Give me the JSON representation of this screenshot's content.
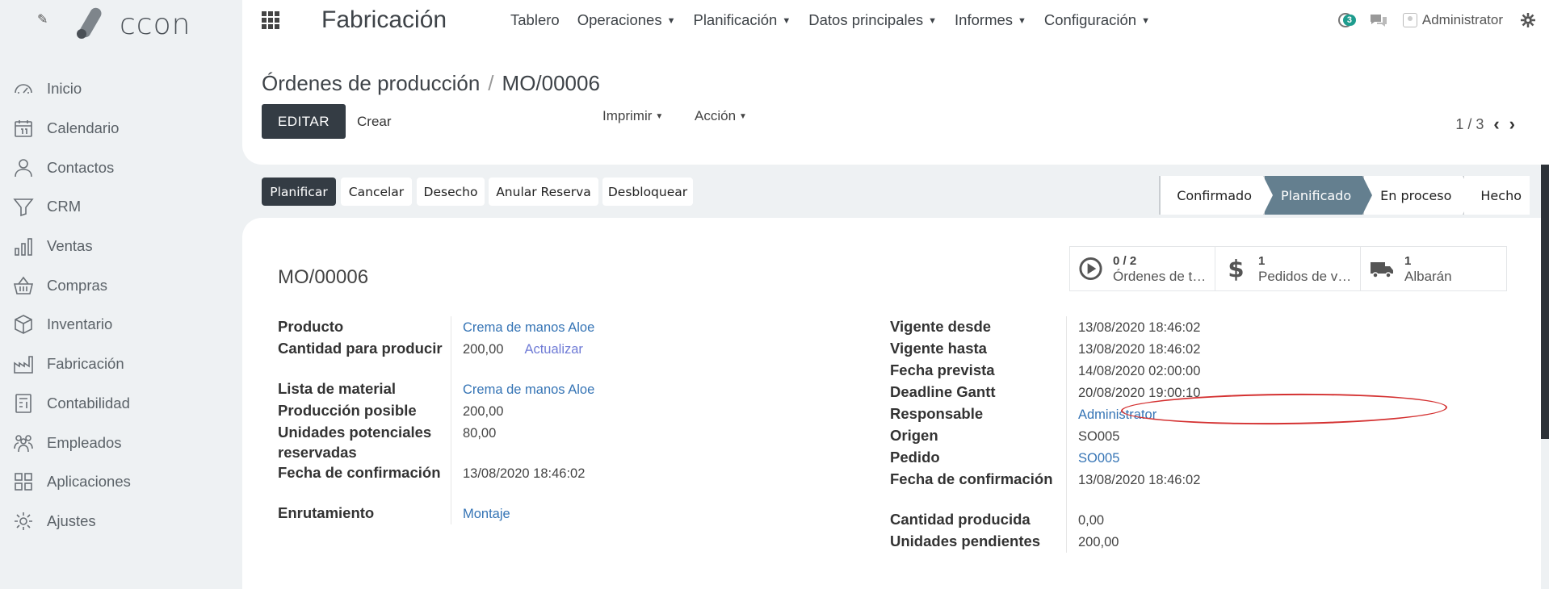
{
  "brand": {
    "logo_text": "ccon"
  },
  "sidebar": {
    "items": [
      {
        "label": "Inicio",
        "icon": "dashboard-icon"
      },
      {
        "label": "Calendario",
        "icon": "calendar-icon"
      },
      {
        "label": "Contactos",
        "icon": "person-icon"
      },
      {
        "label": "CRM",
        "icon": "filter-icon"
      },
      {
        "label": "Ventas",
        "icon": "chart-icon"
      },
      {
        "label": "Compras",
        "icon": "basket-icon"
      },
      {
        "label": "Inventario",
        "icon": "box-icon"
      },
      {
        "label": "Fabricación",
        "icon": "factory-icon"
      },
      {
        "label": "Contabilidad",
        "icon": "accounting-icon"
      },
      {
        "label": "Empleados",
        "icon": "employees-icon"
      },
      {
        "label": "Aplicaciones",
        "icon": "apps-icon"
      },
      {
        "label": "Ajustes",
        "icon": "settings-icon"
      }
    ]
  },
  "topbar": {
    "app_title": "Fabricación",
    "menu": [
      "Tablero",
      "Operaciones",
      "Planificación",
      "Datos principales",
      "Informes",
      "Configuración"
    ],
    "activity_count": "3",
    "user": "Administrator"
  },
  "control": {
    "breadcrumb_parent": "Órdenes de producción",
    "breadcrumb_current": "MO/00006",
    "edit": "EDITAR",
    "create": "Crear",
    "print": "Imprimir",
    "action": "Acción",
    "pager": "1 / 3"
  },
  "statusbar": {
    "buttons": [
      "Planificar",
      "Cancelar",
      "Desecho",
      "Anular Reserva",
      "Desbloquear"
    ],
    "stages": [
      "Confirmado",
      "Planificado",
      "En proceso",
      "Hecho"
    ],
    "active_stage": "Planificado"
  },
  "form": {
    "name": "MO/00006",
    "smart_buttons": [
      {
        "value": "0 / 2",
        "label": "Órdenes de t…",
        "icon": "play-circle-icon"
      },
      {
        "value": "1",
        "label": "Pedidos de v…",
        "icon": "dollar-icon"
      },
      {
        "value": "1",
        "label": "Albarán",
        "icon": "truck-icon"
      }
    ],
    "left": [
      {
        "label": "Producto",
        "value": "Crema de manos Aloe"
      },
      {
        "label": "Cantidad para producir",
        "value": "200,00",
        "extra": "Actualizar"
      },
      {
        "label": "Lista de material",
        "value": "Crema de manos Aloe"
      },
      {
        "label": "Producción posible",
        "value": "200,00"
      },
      {
        "label": "Unidades potenciales reservadas",
        "value": "80,00"
      },
      {
        "label": "Fecha de confirmación",
        "value": "13/08/2020 18:46:02"
      },
      {
        "label": "Enrutamiento",
        "value": "Montaje"
      }
    ],
    "right": [
      {
        "label": "Vigente desde",
        "value": "13/08/2020 18:46:02"
      },
      {
        "label": "Vigente hasta",
        "value": "13/08/2020 18:46:02"
      },
      {
        "label": "Fecha prevista",
        "value": "14/08/2020 02:00:00"
      },
      {
        "label": "Deadline Gantt",
        "value": "20/08/2020 19:00:10"
      },
      {
        "label": "Responsable",
        "value": "Administrator"
      },
      {
        "label": "Origen",
        "value": "SO005"
      },
      {
        "label": "Pedido",
        "value": "SO005"
      },
      {
        "label": "Fecha de confirmación",
        "value": "13/08/2020 18:46:02"
      },
      {
        "label": "Cantidad producida",
        "value": "0,00"
      },
      {
        "label": "Unidades pendientes",
        "value": "200,00"
      }
    ]
  },
  "colors": {
    "dark": "#343c44",
    "stage_active": "#647f8f",
    "link": "#3574b5",
    "annotation": "#d43131",
    "badge": "#1e9c8e"
  }
}
